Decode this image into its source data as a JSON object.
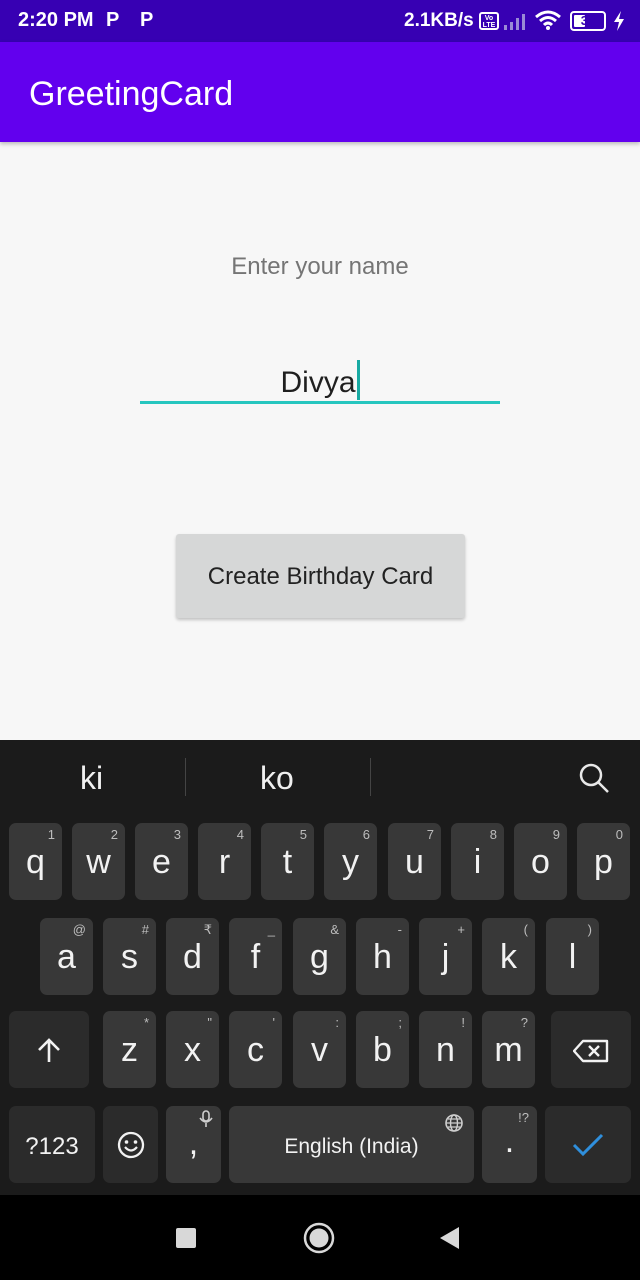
{
  "status_bar": {
    "time": "2:20 PM",
    "notif_icons": [
      "P",
      "P"
    ],
    "net_speed": "2.1KB/s",
    "volte_label": "Vo LTE",
    "battery_level": "39",
    "battery_fraction": 0.39
  },
  "app_bar": {
    "title": "GreetingCard"
  },
  "main": {
    "prompt": "Enter your name",
    "name_value": "Divya",
    "button_label": "Create Birthday Card"
  },
  "keyboard": {
    "suggestions": [
      "ki",
      "ko"
    ],
    "row1": [
      {
        "key": "q",
        "hint": "1"
      },
      {
        "key": "w",
        "hint": "2"
      },
      {
        "key": "e",
        "hint": "3"
      },
      {
        "key": "r",
        "hint": "4"
      },
      {
        "key": "t",
        "hint": "5"
      },
      {
        "key": "y",
        "hint": "6"
      },
      {
        "key": "u",
        "hint": "7"
      },
      {
        "key": "i",
        "hint": "8"
      },
      {
        "key": "o",
        "hint": "9"
      },
      {
        "key": "p",
        "hint": "0"
      }
    ],
    "row2": [
      {
        "key": "a",
        "hint": "@"
      },
      {
        "key": "s",
        "hint": "#"
      },
      {
        "key": "d",
        "hint": "₹"
      },
      {
        "key": "f",
        "hint": "_"
      },
      {
        "key": "g",
        "hint": "&"
      },
      {
        "key": "h",
        "hint": "-"
      },
      {
        "key": "j",
        "hint": "+"
      },
      {
        "key": "k",
        "hint": "("
      },
      {
        "key": "l",
        "hint": ")"
      }
    ],
    "row3": [
      {
        "key": "z",
        "hint": "*"
      },
      {
        "key": "x",
        "hint": "\""
      },
      {
        "key": "c",
        "hint": "'"
      },
      {
        "key": "v",
        "hint": ":"
      },
      {
        "key": "b",
        "hint": ";"
      },
      {
        "key": "n",
        "hint": "!"
      },
      {
        "key": "m",
        "hint": "?"
      }
    ],
    "symbols_label": "?123",
    "comma": ",",
    "space_label": "English (India)",
    "period": ".",
    "period_hint": "!?"
  },
  "icons": {
    "shift": "shift-arrow-icon",
    "backspace": "backspace-icon",
    "emoji": "emoji-icon",
    "mic": "mic-icon",
    "globe": "globe-icon",
    "enter": "checkmark-icon",
    "search": "search-icon"
  },
  "colors": {
    "status_bar": "#3700b3",
    "app_bar": "#6200ee",
    "field_underline": "#26c6bf",
    "button_bg": "#d6d7d7",
    "keyboard_bg": "#1b1b1b",
    "key_bg": "#383838",
    "enter_check": "#2f8fdc"
  }
}
